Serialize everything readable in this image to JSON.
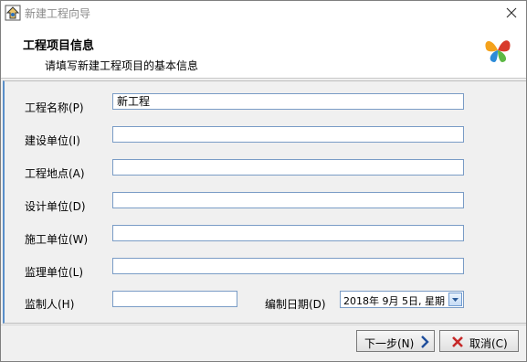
{
  "window": {
    "title": "新建工程向导"
  },
  "header": {
    "title": "工程项目信息",
    "subtitle": "请填写新建工程项目的基本信息"
  },
  "form": {
    "project_name": {
      "label": "工程名称(P)",
      "value": "新工程"
    },
    "construction_unit": {
      "label": "建设单位(I)",
      "value": ""
    },
    "project_location": {
      "label": "工程地点(A)",
      "value": ""
    },
    "design_unit": {
      "label": "设计单位(D)",
      "value": ""
    },
    "contractor": {
      "label": "施工单位(W)",
      "value": ""
    },
    "supervision_unit": {
      "label": "监理单位(L)",
      "value": ""
    },
    "compiler": {
      "label": "监制人(H)",
      "value": ""
    },
    "compile_date": {
      "label": "编制日期(D)",
      "value": "2018年 9月 5日, 星期"
    }
  },
  "buttons": {
    "next": "下一步(N)",
    "cancel": "取消(C)"
  },
  "colors": {
    "field_border": "#7a9cc6",
    "panel_accent": "#5a8fc9",
    "cancel_x": "#c62828",
    "next_arrow": "#1f4e9c"
  }
}
